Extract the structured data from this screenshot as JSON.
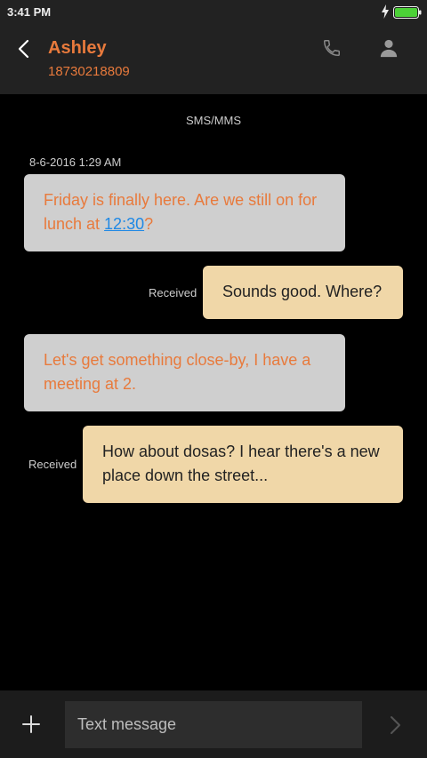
{
  "status_bar": {
    "time": "3:41 PM",
    "battery_color": "#4cd137"
  },
  "header": {
    "contact_name": "Ashley",
    "contact_number": "18730218809",
    "accent_color": "#e87a3c",
    "icons": [
      "back-icon",
      "call-icon",
      "person-icon"
    ]
  },
  "conversation": {
    "channel": "SMS/MMS",
    "date": "8-6-2016 1:29 AM",
    "messages": [
      {
        "direction": "incoming",
        "text_before": "Friday is finally here. Are we still on for lunch at ",
        "link": "12:30",
        "text_after": "?"
      },
      {
        "direction": "outgoing",
        "status": "Received",
        "text": "Sounds good. Where?"
      },
      {
        "direction": "incoming",
        "text": "Let's get something close-by, I have a meeting at 2."
      },
      {
        "direction": "outgoing",
        "status": "Received",
        "text": "How about dosas? I hear there's a new place down the street..."
      }
    ]
  },
  "composer": {
    "placeholder": "Text message",
    "value": "",
    "icons": [
      "add-icon",
      "send-icon"
    ]
  }
}
